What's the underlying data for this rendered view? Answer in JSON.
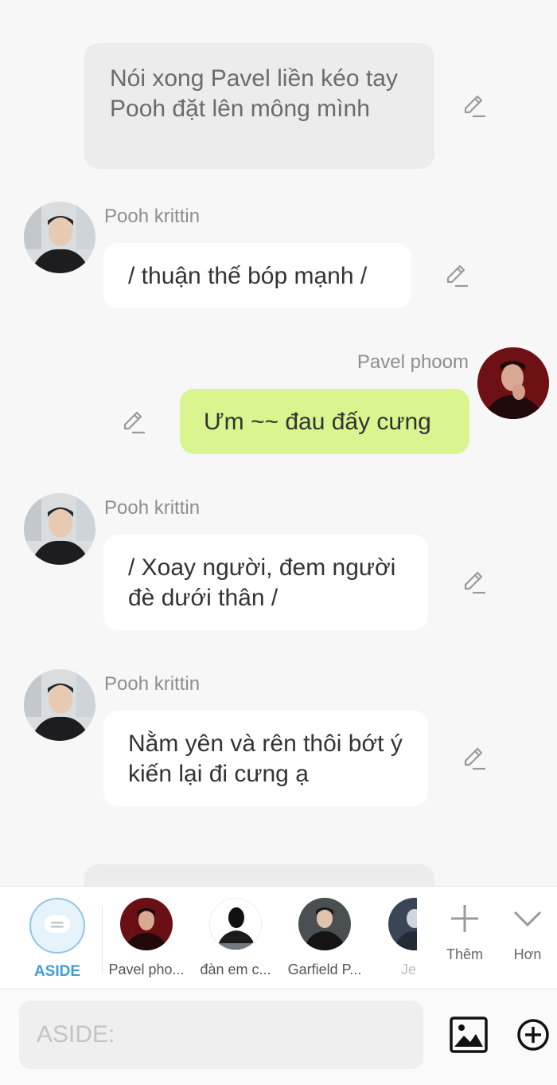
{
  "messages": [
    {
      "type": "aside",
      "text": "Nói xong Pavel liền kéo tay Pooh đặt lên mông mình"
    },
    {
      "type": "left",
      "sender": "Pooh krittin",
      "text": "/ thuận thế bóp mạnh /"
    },
    {
      "type": "right",
      "sender": "Pavel phoom",
      "text": "Ưm ~~ đau đấy cưng"
    },
    {
      "type": "left",
      "sender": "Pooh krittin",
      "text": "/ Xoay người, đem người đè dưới thân /"
    },
    {
      "type": "left",
      "sender": "Pooh krittin",
      "text": "Nằm yên và rên thôi bớt ý kiến lại đi cưng ạ"
    }
  ],
  "characters": [
    {
      "label": "ASIDE",
      "selected": true
    },
    {
      "label": "Pavel pho..."
    },
    {
      "label": "đàn em c..."
    },
    {
      "label": "Garfield P..."
    },
    {
      "label": "Je"
    }
  ],
  "tools": {
    "add_label": "Thêm",
    "more_label": "Hơn"
  },
  "input": {
    "placeholder": "ASIDE:"
  },
  "icons": {
    "edit": "pencil-edit-icon",
    "aside": "chat-bubble-icon",
    "add": "plus-icon",
    "more": "chevron-down-icon",
    "image": "image-icon",
    "attach": "circle-plus-icon"
  },
  "colors": {
    "background": "#f7f7f7",
    "aside_bubble": "#ececec",
    "left_bubble": "#ffffff",
    "right_bubble": "#d8f58f",
    "accent": "#3f9cd6"
  }
}
